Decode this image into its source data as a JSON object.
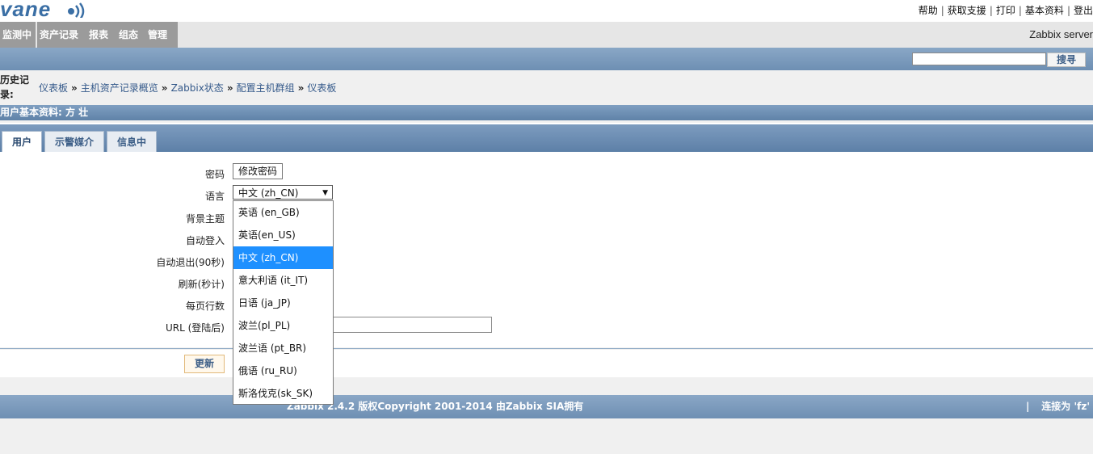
{
  "logo": {
    "text": "vane"
  },
  "top_links": [
    "帮助",
    "获取支援",
    "打印",
    "基本资料",
    "登出"
  ],
  "main_nav": [
    "监测中",
    "资产记录",
    "报表",
    "组态",
    "管理"
  ],
  "server_name": "Zabbix server",
  "search": {
    "button_label": "搜寻",
    "value": ""
  },
  "history": {
    "label_line1": "历史记",
    "label_line2": "录:",
    "items": [
      "仪表板",
      "主机资产记录概览",
      "Zabbix状态",
      "配置主机群组",
      "仪表板"
    ],
    "separator": "»"
  },
  "section_title": "用户基本资料: 方 壮",
  "tabs": [
    {
      "label": "用户",
      "active": true
    },
    {
      "label": "示警媒介",
      "active": false
    },
    {
      "label": "信息中",
      "active": false
    }
  ],
  "form": {
    "labels": {
      "password": "密码",
      "language": "语言",
      "theme": "背景主题",
      "autologin": "自动登入",
      "autologout": "自动退出(90秒)",
      "refresh": "刷新(秒计)",
      "rows_per_page": "每页行数",
      "url": "URL (登陆后)"
    },
    "change_password_button": "修改密码",
    "language_selected": "中文 (zh_CN)",
    "language_options": [
      "英语 (en_GB)",
      "英语(en_US)",
      "中文 (zh_CN)",
      "意大利语 (it_IT)",
      "日语 (ja_JP)",
      "波兰(pl_PL)",
      "波兰语 (pt_BR)",
      "俄语 (ru_RU)",
      "斯洛伐克(sk_SK)"
    ],
    "language_highlight_index": 2,
    "url_value": ""
  },
  "update_button": "更新",
  "footer": {
    "copyright": "Zabbix 2.4.2 版权Copyright 2001-2014 由Zabbix SIA拥有",
    "pipe": "|",
    "connected": "连接为 'fz'"
  },
  "colors": {
    "band_blue": "#6e8fb3",
    "nav_gray": "#9b9b9b",
    "link_blue": "#34598a",
    "selected_option": "#1e90ff"
  }
}
